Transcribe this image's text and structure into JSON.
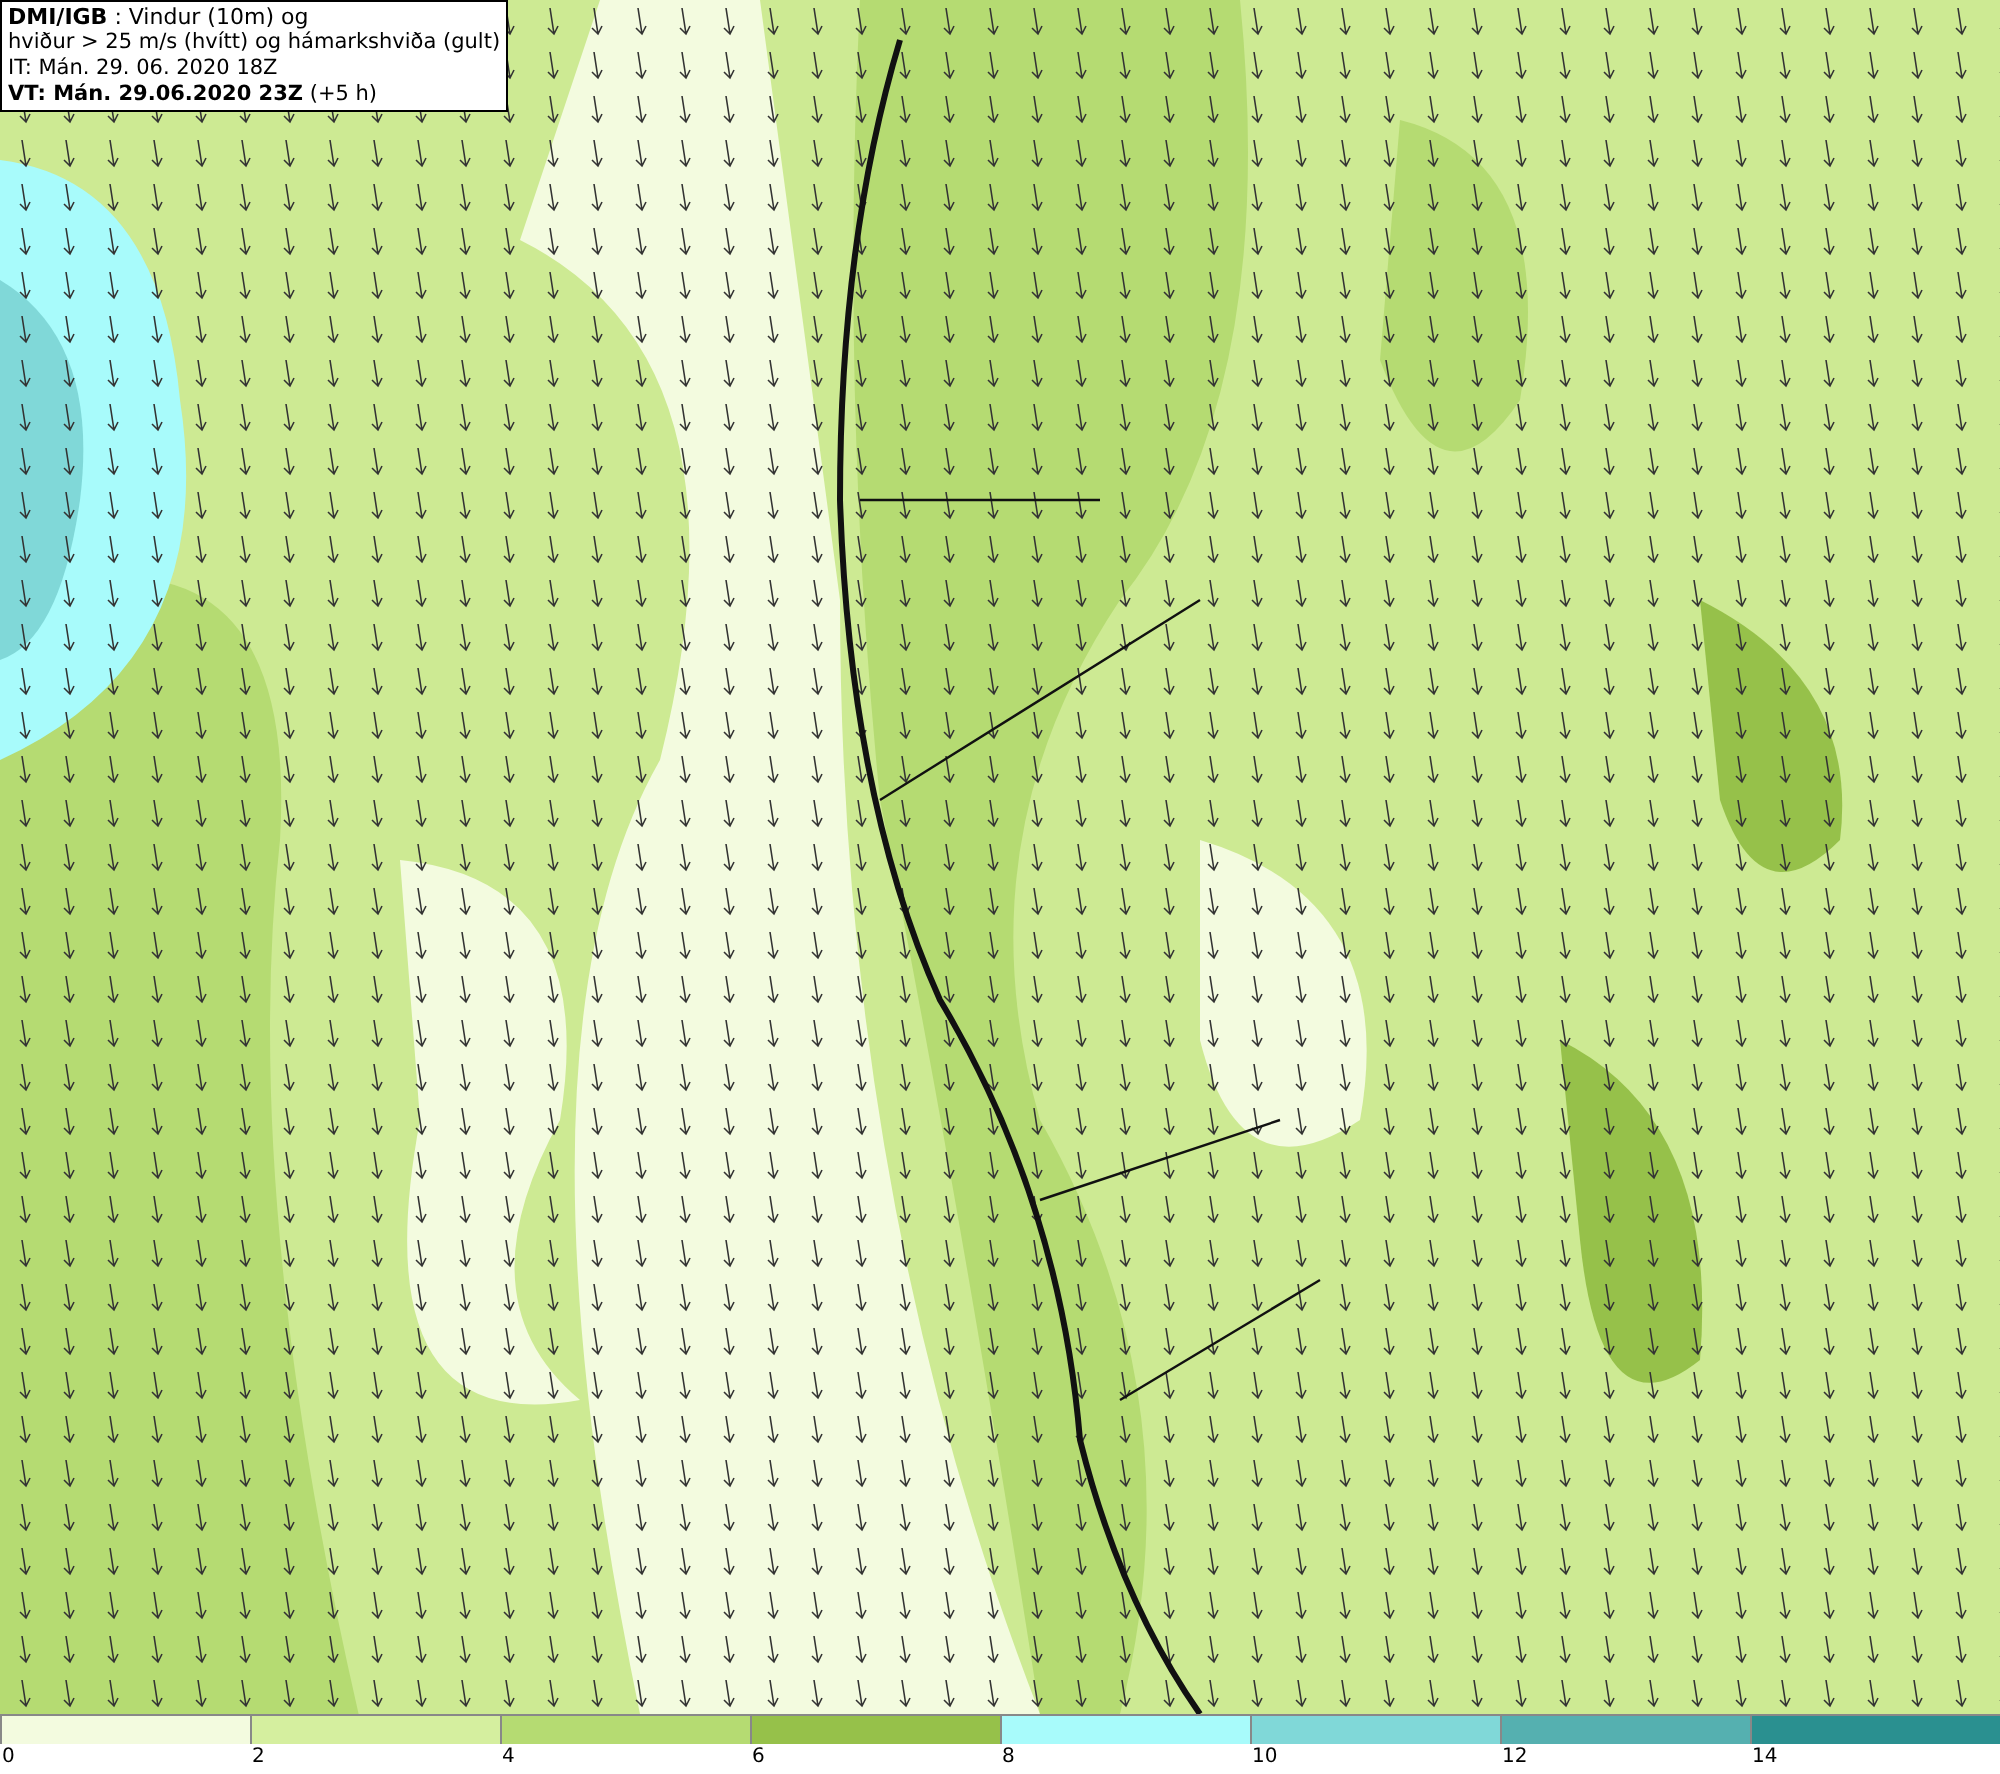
{
  "legend": {
    "lines": [
      "**DMI/IGB** : Vindur (10m) og",
      "hviður > 25 m/s (hvítt) og hámarkshviða (gult)",
      "IT: Mán. 29. 06. 2020 18Z",
      "**VT: Mán. 29.06.2020 23Z** (+5 h)"
    ]
  },
  "colorbar": {
    "segments": [
      {
        "label": "0",
        "color": "#f3fbdf"
      },
      {
        "label": "2",
        "color": "#d5ef9f"
      },
      {
        "label": "4",
        "color": "#b5db72"
      },
      {
        "label": "6",
        "color": "#96c14a"
      },
      {
        "label": "8",
        "color": "#a8fbfb"
      },
      {
        "label": "10",
        "color": "#80d8d8"
      },
      {
        "label": "12",
        "color": "#55b0b0"
      },
      {
        "label": "14",
        "color": "#2a9090"
      }
    ]
  }
}
